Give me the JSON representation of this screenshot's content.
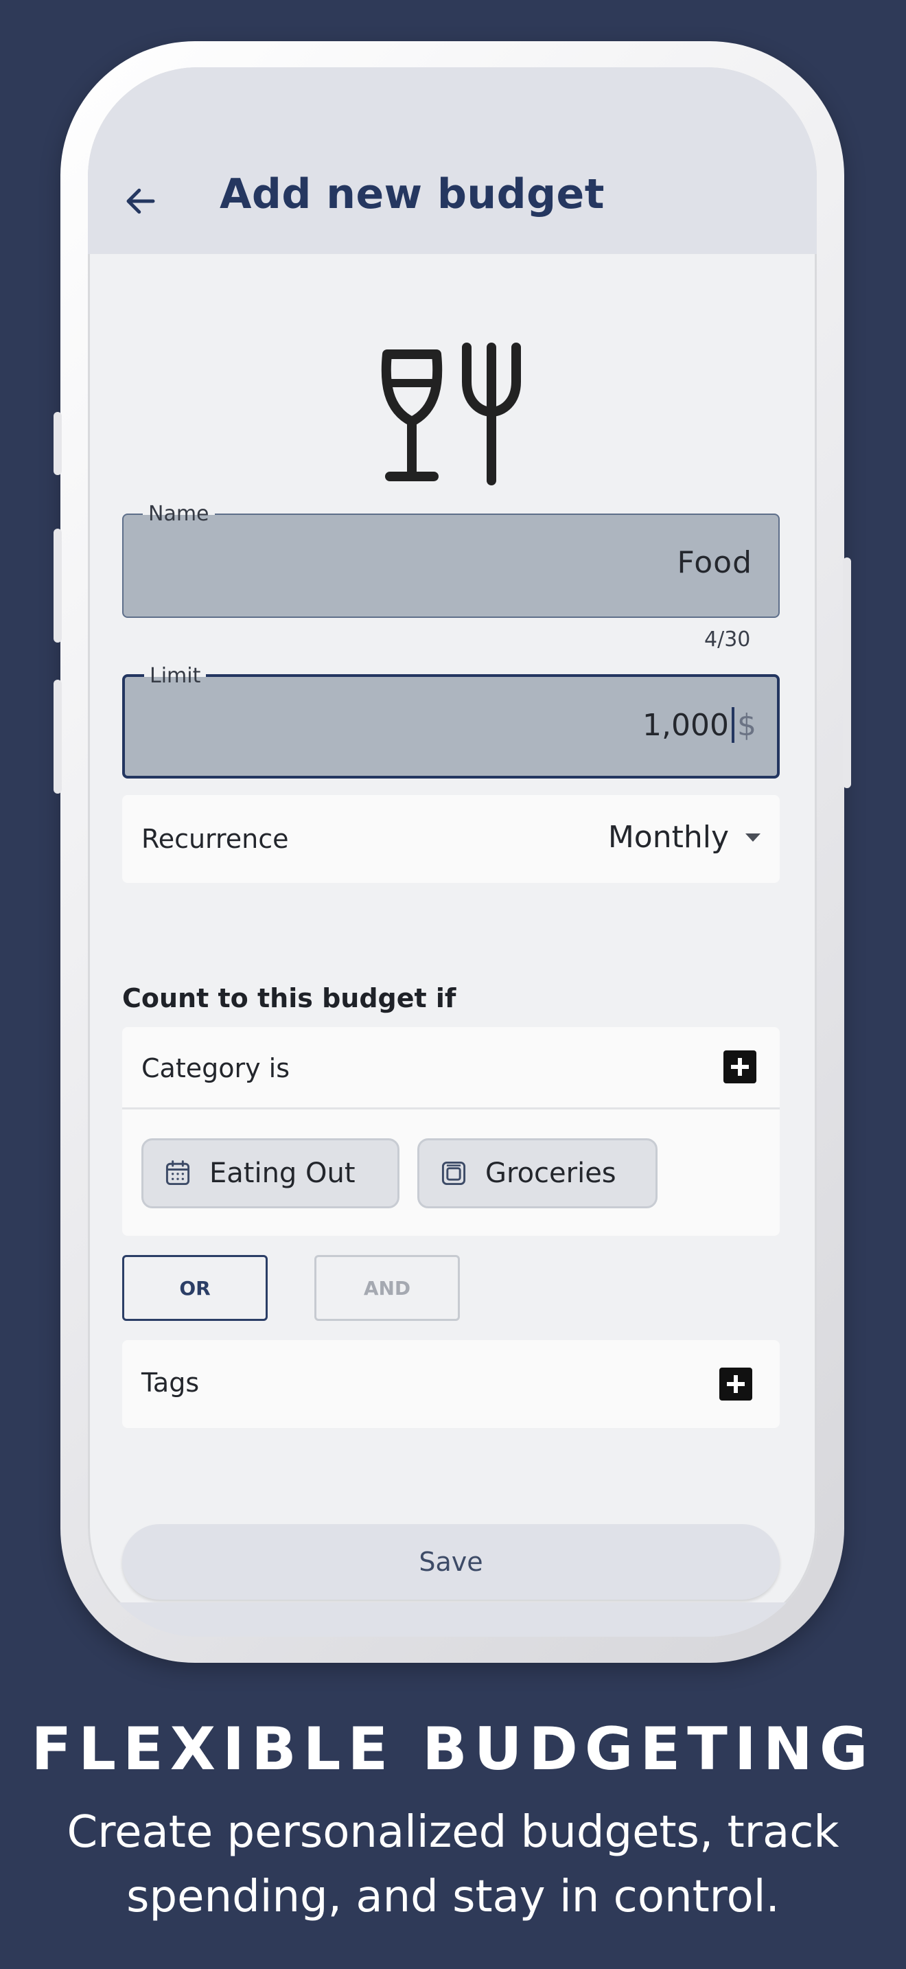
{
  "app_bar": {
    "title": "Add new budget",
    "back_icon": "arrow-left-icon"
  },
  "budget_icon": "wine-glass-fork-icon",
  "name_field": {
    "label": "Name",
    "value": "Food",
    "counter": "4/30"
  },
  "limit_field": {
    "label": "Limit",
    "value": "1,000",
    "suffix": "$"
  },
  "recurrence": {
    "label": "Recurrence",
    "value": "Monthly"
  },
  "conditions": {
    "title": "Count to this budget if",
    "category": {
      "label": "Category is",
      "chips": [
        {
          "label": "Eating Out",
          "icon": "calendar-icon"
        },
        {
          "label": "Groceries",
          "icon": "square-icon"
        }
      ]
    },
    "logic": {
      "or_label": "OR",
      "and_label": "AND",
      "selected": "OR"
    },
    "tags": {
      "label": "Tags"
    }
  },
  "save_label": "Save",
  "marketing": {
    "headline": "FLEXIBLE BUDGETING",
    "subline_1": "Create personalized budgets, track",
    "subline_2": "spending, and stay in control."
  },
  "colors": {
    "background": "#2f3a58",
    "accent": "#253760",
    "field_fill": "#adb5bf"
  }
}
